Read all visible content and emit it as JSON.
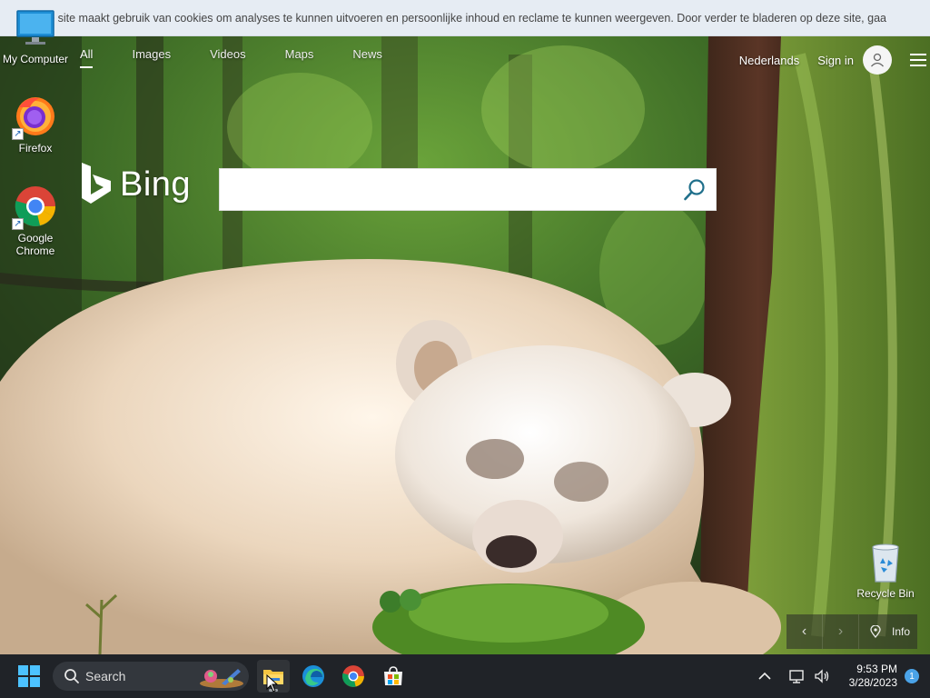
{
  "cookie_banner": {
    "text": "eze site maakt gebruik van cookies om analyses te kunnen uitvoeren en persoonlijke inhoud en reclame te kunnen weergeven. Door verder te bladeren op deze site, gaa"
  },
  "bing": {
    "nav": [
      {
        "label": "All",
        "active": true
      },
      {
        "label": "Images",
        "active": false
      },
      {
        "label": "Videos",
        "active": false
      },
      {
        "label": "Maps",
        "active": false
      },
      {
        "label": "News",
        "active": false
      }
    ],
    "language": "Nederlands",
    "signin": "Sign in",
    "logo_text": "Bing",
    "search": {
      "value": "",
      "placeholder": ""
    },
    "info_label": "Info",
    "colors": {
      "search_icon": "#1f6f8b",
      "logo": "#ffffff"
    }
  },
  "desktop": {
    "icons": [
      {
        "label": "My Computer",
        "icon": "monitor-icon"
      },
      {
        "label": "Firefox",
        "icon": "firefox-icon"
      },
      {
        "label": "Google Chrome",
        "icon": "chrome-icon"
      },
      {
        "label": "Recycle Bin",
        "icon": "recycle-bin-icon"
      }
    ]
  },
  "taskbar": {
    "search_label": "Search",
    "apps": [
      {
        "name": "File Explorer",
        "icon": "folder-icon",
        "active": true
      },
      {
        "name": "Microsoft Edge",
        "icon": "edge-icon",
        "active": false
      },
      {
        "name": "Google Chrome",
        "icon": "chrome-icon",
        "active": false
      },
      {
        "name": "Microsoft Store",
        "icon": "store-icon",
        "active": false
      }
    ],
    "time": "9:53 PM",
    "date": "3/28/2023",
    "notification_count": "1"
  }
}
